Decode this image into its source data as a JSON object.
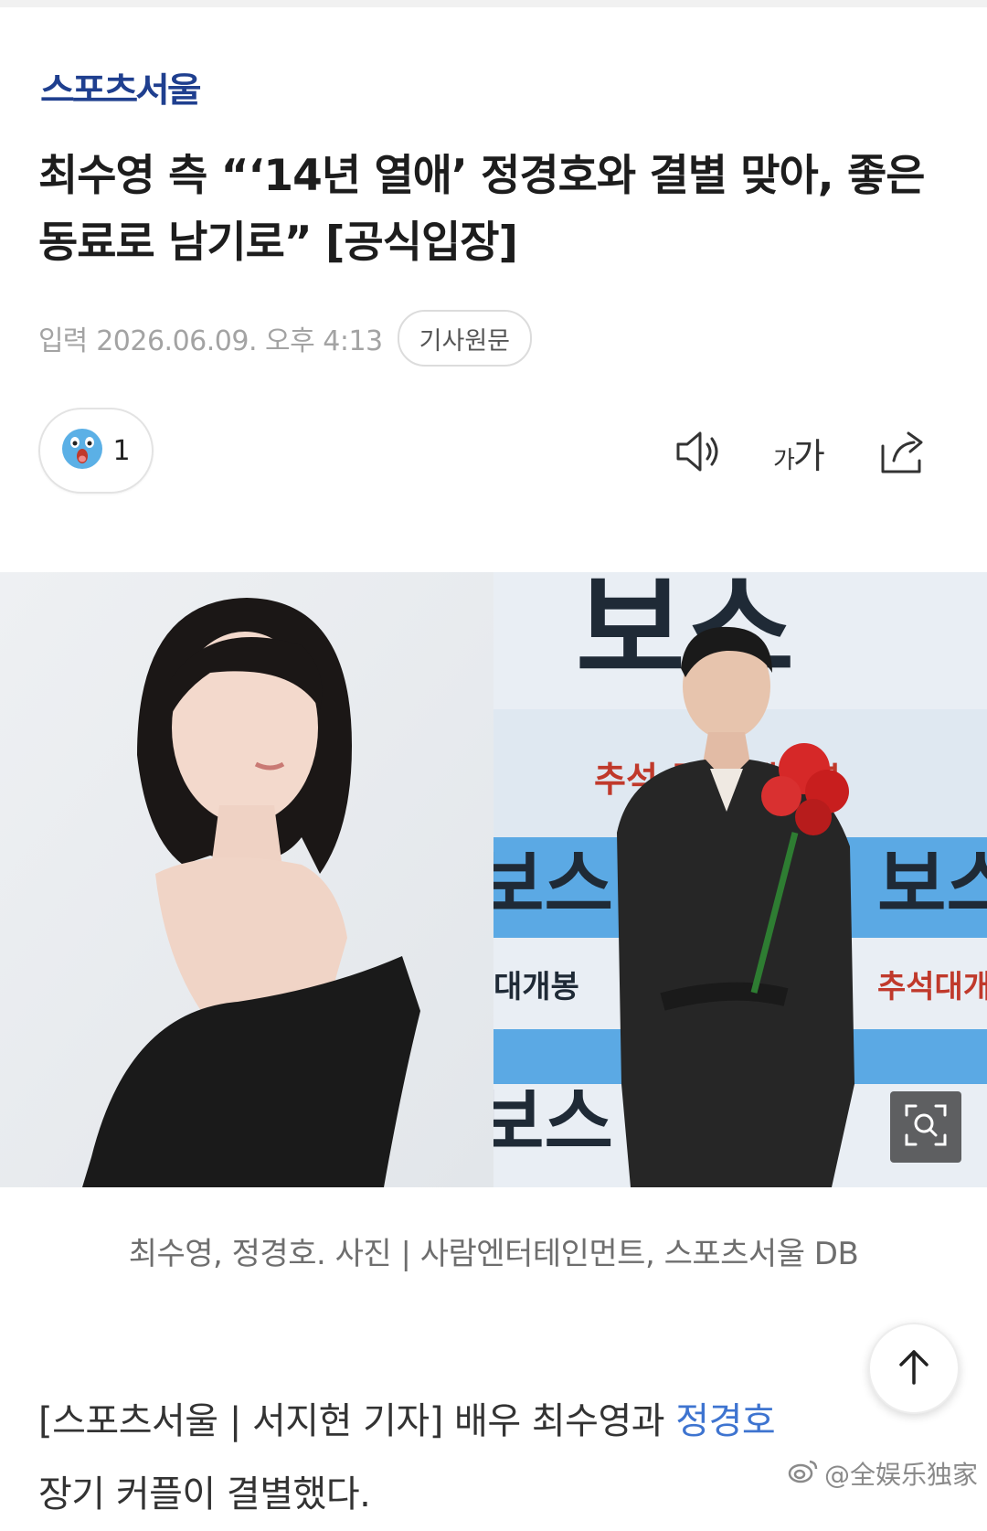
{
  "header": {
    "logo_text": "스포츠서울"
  },
  "article": {
    "title": "최수영 측 “‘14년 열애’ 정경호와 결별 맞아, 좋은 동료로 남기로” [공식입장]",
    "date_label": "입력",
    "date_value": "2026.06.09. 오후 4:13",
    "origin_button": "기사원문",
    "reaction_count": "1",
    "font_size_label_small": "가",
    "font_size_label_large": "가",
    "photo": {
      "right_backdrop_title": "보스",
      "right_backdrop_subtitle": "추석 극장 대개봉",
      "right_backdrop_subtitle_side": "추석대개",
      "right_backdrop_tag": "대개봉"
    },
    "caption": "최수영, 정경호. 사진 | 사람엔터테인먼트, 스포츠서울 DB",
    "body": {
      "prefix": "[스포츠서울 | 서지현 기자] 배우 최수영과 ",
      "link_text": "정경호",
      "line2": "장기 커플이 결별했다."
    }
  },
  "watermark": "@全娱乐独家",
  "icons": {
    "reaction": "surprised-face-icon",
    "speaker": "speaker-icon",
    "share": "share-icon",
    "zoom": "zoom-icon",
    "back_to_top": "arrow-up-icon"
  },
  "colors": {
    "logo": "#1f3f8f",
    "link": "#3e74d0",
    "muted": "#a3a3a3"
  }
}
